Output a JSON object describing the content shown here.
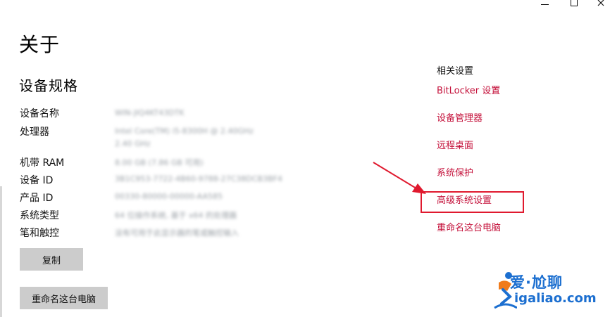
{
  "window_controls": {
    "minimize": "minimize",
    "maximize": "maximize",
    "close": "close"
  },
  "page_title": "关于",
  "device_specs": {
    "section_title": "设备规格",
    "rows": [
      {
        "label": "设备名称",
        "value": "WIN-JIQ4KT43DTK"
      },
      {
        "label": "处理器",
        "value": "Intel Core(TM) i5-8300H @ 2.40GHz",
        "value_line2": "2.40 GHz"
      },
      {
        "label": "机带 RAM",
        "value": "8.00 GB (7.86 GB 可用)"
      },
      {
        "label": "设备 ID",
        "value": "3B1C953-7722-4B60-9788-27C38DCB3BF4"
      },
      {
        "label": "产品 ID",
        "value": "00330-80000-00000-AA585"
      },
      {
        "label": "系统类型",
        "value": "64 位操作系统, 基于 x64 的处理器"
      },
      {
        "label": "笔和触控",
        "value": "没有可用于此显示器的笔或触控输入"
      }
    ],
    "copy_button": "复制",
    "rename_button": "重命名这台电脑"
  },
  "related_settings": {
    "title": "相关设置",
    "links": [
      "BitLocker 设置",
      "设备管理器",
      "远程桌面",
      "系统保护",
      "高级系统设置",
      "重命名这台电脑"
    ]
  },
  "annotation": {
    "highlighted_link": "高级系统设置",
    "color": "#e0192e"
  },
  "watermark": {
    "cn": "爱·尬聊",
    "en": "igaliao.com"
  },
  "colors": {
    "link": "#c4103a",
    "button_bg": "#cccccc",
    "watermark": "#1c6fd0"
  }
}
